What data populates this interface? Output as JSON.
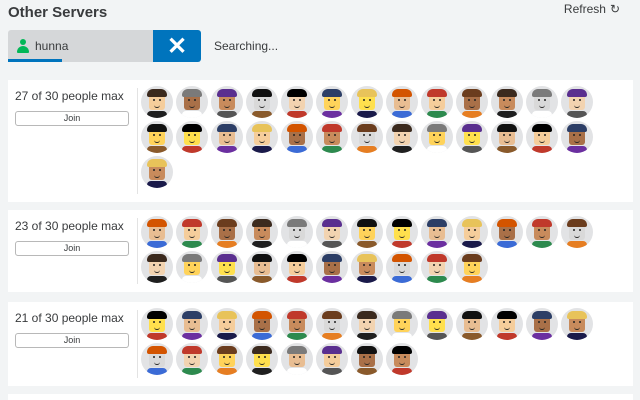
{
  "header": {
    "title": "Other Servers",
    "refresh_label": "Refresh",
    "refresh_icon": "refresh-icon"
  },
  "search": {
    "value": "hunna",
    "status": "Searching...",
    "clear_label": "✕",
    "accent": "#0074bd",
    "user_icon_color": "#02b757"
  },
  "servers": [
    {
      "count_label": "27 of 30 people max",
      "join_label": "Join",
      "players": 27
    },
    {
      "count_label": "23 of 30 people max",
      "join_label": "Join",
      "players": 23
    },
    {
      "count_label": "21 of 30 people max",
      "join_label": "Join",
      "players": 21
    }
  ],
  "avatar_palette": {
    "skin": [
      "#f5cd9b",
      "#ffd35a",
      "#c88b5c",
      "#e8bd92",
      "#f2d3b0",
      "#a97048",
      "#ffe04d",
      "#d9d9d9"
    ],
    "hair": [
      "#3b2a1e",
      "#111111",
      "#e8c35a",
      "#6b3d1e",
      "#5a2f8f",
      "#2c3e66",
      "#c0392b",
      "#7a7a7a",
      "#000000",
      "#d35400"
    ],
    "torso": [
      "#1f1f1f",
      "#3b6bd6",
      "#c0392b",
      "#ffffff",
      "#2d8a4e",
      "#6b2fa0",
      "#555555",
      "#e67e22",
      "#1a1a4a",
      "#8a5a2b"
    ]
  }
}
